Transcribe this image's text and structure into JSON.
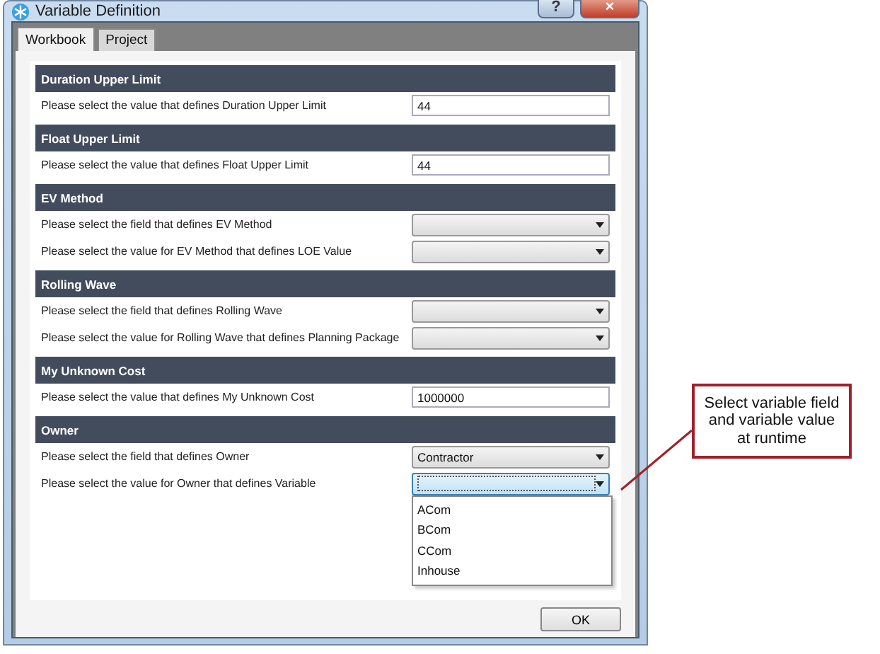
{
  "window": {
    "title": "Variable Definition",
    "help": "?",
    "close": "×"
  },
  "tabs": [
    {
      "label": "Workbook",
      "selected": true
    },
    {
      "label": "Project",
      "selected": false
    }
  ],
  "sections": [
    {
      "title": "Duration Upper Limit",
      "rows": [
        {
          "kind": "text",
          "label": "Please select the value that defines Duration Upper Limit",
          "value": "44"
        }
      ]
    },
    {
      "title": "Float Upper Limit",
      "rows": [
        {
          "kind": "text",
          "label": "Please select the value that defines Float Upper Limit",
          "value": "44"
        }
      ]
    },
    {
      "title": "EV Method",
      "rows": [
        {
          "kind": "combo",
          "label": "Please select the field that defines EV Method",
          "expanded": false
        },
        {
          "kind": "combo",
          "label": "Please select the value for EV Method that defines LOE Value",
          "expanded": false
        }
      ]
    },
    {
      "title": "Rolling Wave",
      "rows": [
        {
          "kind": "combo",
          "label": "Please select the field that defines Rolling Wave",
          "expanded": false
        },
        {
          "kind": "combo",
          "label": "Please select the value for Rolling Wave that defines Planning Package",
          "expanded": false
        }
      ]
    },
    {
      "title": "My Unknown Cost",
      "rows": [
        {
          "kind": "text",
          "label": "Please select the value that defines My Unknown Cost",
          "value": "1000000"
        }
      ]
    },
    {
      "title": "Owner",
      "rows": [
        {
          "kind": "combo",
          "label": "Please select the field that defines Owner",
          "value": "Contractor",
          "expanded": false
        },
        {
          "kind": "combo",
          "label": "Please select the value for Owner that defines Variable",
          "expanded": true,
          "options": [
            "ACom",
            "BCom",
            "CCom",
            "Inhouse"
          ]
        }
      ]
    }
  ],
  "ok_button": "OK",
  "callout": "Select variable field and variable value at runtime"
}
